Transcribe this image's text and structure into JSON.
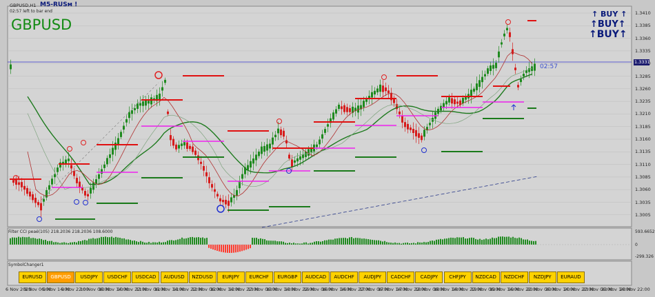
{
  "window": {
    "title": "GBPUSD,H1",
    "brand": "M5-RUSм !",
    "time_left": "02:57 left to bar end",
    "symbol_big": "GBPUSD",
    "countdown": "02:57",
    "current_price": "1.3331"
  },
  "buy_signals": [
    "↑ BUY ↑",
    "↑BUY↑",
    "↑BUY↑"
  ],
  "price_axis": [
    "1.3410",
    "1.3385",
    "1.3360",
    "1.3335",
    "1.3310",
    "1.3285",
    "1.3260",
    "1.3235",
    "1.3210",
    "1.3185",
    "1.3160",
    "1.3135",
    "1.3110",
    "1.3085",
    "1.3060",
    "1.3035",
    "1.3005"
  ],
  "indicator": {
    "label": "Filter CCI peaé(105) 218.2036 218.2036 108.6000",
    "axis_top": "593.6652",
    "axis_mid": "0",
    "axis_bottom": "-299.326"
  },
  "symbol_panel": {
    "label": "SymbolChanger1",
    "symbols": [
      "EURUSD",
      "GBPUSD",
      "USDJPY",
      "USDCHF",
      "USDCAD",
      "AUDUSD",
      "NZDUSD",
      "EURJPY",
      "EURCHF",
      "EURGBP",
      "AUDCAD",
      "AUDCHF",
      "AUDJPY",
      "CADCHF",
      "CADJPY",
      "CHFJPY",
      "NZDCAD",
      "NZDCHF",
      "NZDJPY",
      "EURAUD"
    ],
    "active": "GBPUSD"
  },
  "time_axis": [
    "6 Nov 2020",
    "9 Nov 06:00",
    "9 Nov 14:00",
    "9 Nov 22:00",
    "10 Nov 06:00",
    "10 Nov 14:00",
    "10 Nov 22:00",
    "11 Nov 06:00",
    "11 Nov 14:00",
    "11 Nov 22:00",
    "12 Nov 06:00",
    "12 Nov 14:00",
    "12 Nov 22:00",
    "13 Nov 06:00",
    "13 Nov 14:00",
    "13 Nov 22:00",
    "16 Nov 06:00",
    "16 Nov 14:00",
    "16 Nov 22:00",
    "17 Nov 06:00",
    "17 Nov 14:00",
    "17 Nov 22:00",
    "18 Nov 06:00",
    "18 Nov 14:00",
    "18 Nov 22:00",
    "19 Nov 06:00",
    "19 Nov 14:00",
    "19 Nov 22:00",
    "20 Nov 06:00",
    "20 Nov 14:00",
    "20 Nov 22:00",
    "23 Nov 06:00",
    "23 Nov 14:00",
    "23 Nov 22:00"
  ],
  "colors": {
    "bull": "#1f8a1f",
    "bear": "#d61c1c",
    "ma_slow": "#1e7a1e",
    "ma_fast": "#b03030",
    "support": "#1a7a1a",
    "resistance": "#e01010",
    "mid": "#ee22ee",
    "price_line": "#3333cc",
    "buy_text": "#0a1a7a"
  }
}
